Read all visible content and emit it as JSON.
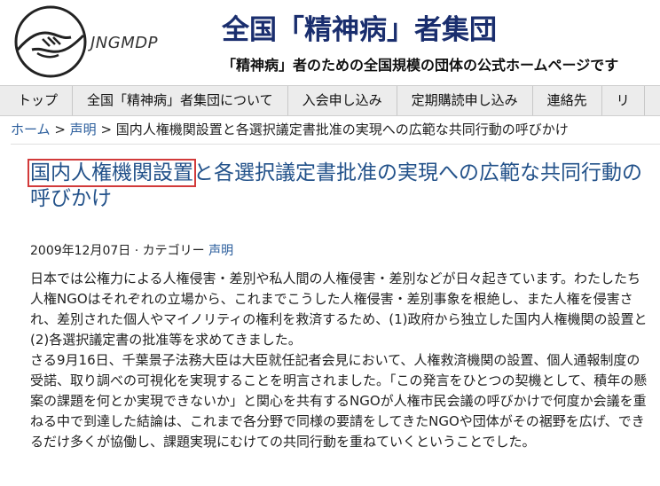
{
  "header": {
    "logo_text": "JNGMDP",
    "title": "全国「精神病」者集団",
    "subtitle": "「精神病」者のための全国規模の団体の公式ホームページです"
  },
  "nav": {
    "items": [
      {
        "label": "トップ"
      },
      {
        "label": "全国「精神病」者集団について"
      },
      {
        "label": "入会申し込み"
      },
      {
        "label": "定期購読申し込み"
      },
      {
        "label": "連絡先"
      },
      {
        "label": "リ"
      }
    ]
  },
  "breadcrumb": {
    "home": "ホーム",
    "sep1": " > ",
    "category": "声明",
    "sep2": " > ",
    "current": "国内人権機関設置と各選択議定書批准の実現への広範な共同行動の呼びかけ"
  },
  "article": {
    "title_highlight": "国内人権機関設置",
    "title_rest": "と各選択議定書批准の実現への広範な共同行動の呼びかけ",
    "date": "2009年12月07日",
    "meta_sep": " · カテゴリー ",
    "category": "声明",
    "paragraphs": [
      "日本では公権力による人権侵害・差別や私人間の人権侵害・差別などが日々起きています。わたしたち人権NGOはそれぞれの立場から、これまでこうした人権侵害・差別事象を根絶し、また人権を侵害され、差別された個人やマイノリティの権利を救済するため、(1)政府から独立した国内人権機関の設置と(2)各選択議定書の批准等を求めてきました。",
      "さる9月16日、千葉景子法務大臣は大臣就任記者会見において、人権救済機関の設置、個人通報制度の受諾、取り調べの可視化を実現することを明言されました。「この発言をひとつの契機として、積年の懸案の課題を何とか実現できないか」と関心を共有するNGOが人権市民会議の呼びかけで何度か会議を重ねる中で到達した結論は、これまで各分野で同様の要請をしてきたNGOや団体がその裾野を広げ、できるだけ多くが協働し、課題実現にむけての共同行動を重ねていくということでした。"
    ]
  }
}
